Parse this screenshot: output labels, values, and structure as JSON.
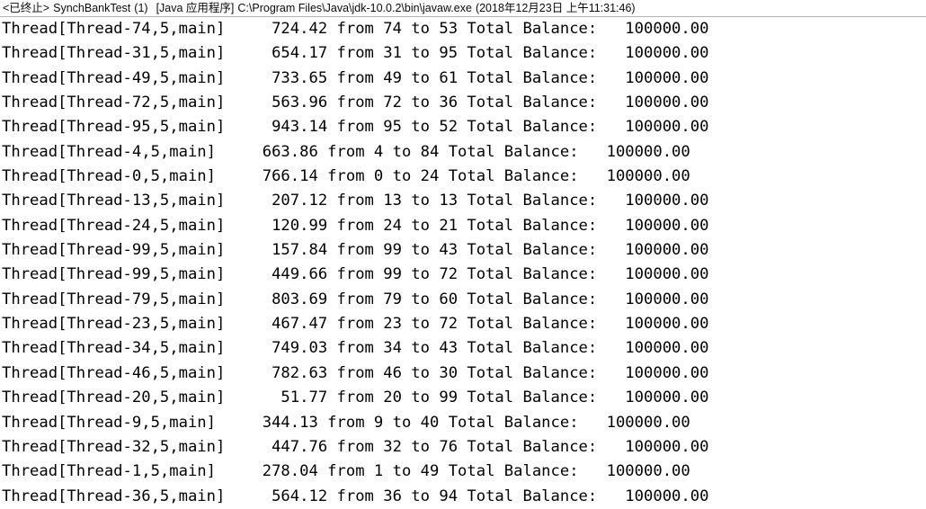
{
  "header": {
    "status": "<已终止>",
    "launch_config": "SynchBankTest",
    "instance": "(1)",
    "app_type": "[Java 应用程序]",
    "executable_path": "C:\\Program Files\\Java\\jdk-10.0.2\\bin\\javaw.exe",
    "timestamp": "(2018年12月23日 上午11:31:46)"
  },
  "console": {
    "format": "Thread[Thread-%d,5,main] %10.2f from %d to %d Total Balance: %10.2f",
    "total_balance_label": "Total Balance:",
    "from_label": "from",
    "to_label": "to",
    "lines": [
      "Thread[Thread-74,5,main]     724.42 from 74 to 53 Total Balance:   100000.00",
      "Thread[Thread-31,5,main]     654.17 from 31 to 95 Total Balance:   100000.00",
      "Thread[Thread-49,5,main]     733.65 from 49 to 61 Total Balance:   100000.00",
      "Thread[Thread-72,5,main]     563.96 from 72 to 36 Total Balance:   100000.00",
      "Thread[Thread-95,5,main]     943.14 from 95 to 52 Total Balance:   100000.00",
      "Thread[Thread-4,5,main]     663.86 from 4 to 84 Total Balance:   100000.00",
      "Thread[Thread-0,5,main]     766.14 from 0 to 24 Total Balance:   100000.00",
      "Thread[Thread-13,5,main]     207.12 from 13 to 13 Total Balance:   100000.00",
      "Thread[Thread-24,5,main]     120.99 from 24 to 21 Total Balance:   100000.00",
      "Thread[Thread-99,5,main]     157.84 from 99 to 43 Total Balance:   100000.00",
      "Thread[Thread-99,5,main]     449.66 from 99 to 72 Total Balance:   100000.00",
      "Thread[Thread-79,5,main]     803.69 from 79 to 60 Total Balance:   100000.00",
      "Thread[Thread-23,5,main]     467.47 from 23 to 72 Total Balance:   100000.00",
      "Thread[Thread-34,5,main]     749.03 from 34 to 43 Total Balance:   100000.00",
      "Thread[Thread-46,5,main]     782.63 from 46 to 30 Total Balance:   100000.00",
      "Thread[Thread-20,5,main]      51.77 from 20 to 99 Total Balance:   100000.00",
      "Thread[Thread-9,5,main]     344.13 from 9 to 40 Total Balance:   100000.00",
      "Thread[Thread-32,5,main]     447.76 from 32 to 76 Total Balance:   100000.00",
      "Thread[Thread-1,5,main]     278.04 from 1 to 49 Total Balance:   100000.00",
      "Thread[Thread-36,5,main]     564.12 from 36 to 94 Total Balance:   100000.00"
    ],
    "records": [
      {
        "thread": 74,
        "amount": "724.42",
        "from": 74,
        "to": 53,
        "total_balance": "100000.00"
      },
      {
        "thread": 31,
        "amount": "654.17",
        "from": 31,
        "to": 95,
        "total_balance": "100000.00"
      },
      {
        "thread": 49,
        "amount": "733.65",
        "from": 49,
        "to": 61,
        "total_balance": "100000.00"
      },
      {
        "thread": 72,
        "amount": "563.96",
        "from": 72,
        "to": 36,
        "total_balance": "100000.00"
      },
      {
        "thread": 95,
        "amount": "943.14",
        "from": 95,
        "to": 52,
        "total_balance": "100000.00"
      },
      {
        "thread": 4,
        "amount": "663.86",
        "from": 4,
        "to": 84,
        "total_balance": "100000.00"
      },
      {
        "thread": 0,
        "amount": "766.14",
        "from": 0,
        "to": 24,
        "total_balance": "100000.00"
      },
      {
        "thread": 13,
        "amount": "207.12",
        "from": 13,
        "to": 13,
        "total_balance": "100000.00"
      },
      {
        "thread": 24,
        "amount": "120.99",
        "from": 24,
        "to": 21,
        "total_balance": "100000.00"
      },
      {
        "thread": 99,
        "amount": "157.84",
        "from": 99,
        "to": 43,
        "total_balance": "100000.00"
      },
      {
        "thread": 99,
        "amount": "449.66",
        "from": 99,
        "to": 72,
        "total_balance": "100000.00"
      },
      {
        "thread": 79,
        "amount": "803.69",
        "from": 79,
        "to": 60,
        "total_balance": "100000.00"
      },
      {
        "thread": 23,
        "amount": "467.47",
        "from": 23,
        "to": 72,
        "total_balance": "100000.00"
      },
      {
        "thread": 34,
        "amount": "749.03",
        "from": 34,
        "to": 43,
        "total_balance": "100000.00"
      },
      {
        "thread": 46,
        "amount": "782.63",
        "from": 46,
        "to": 30,
        "total_balance": "100000.00"
      },
      {
        "thread": 20,
        "amount": "51.77",
        "from": 20,
        "to": 99,
        "total_balance": "100000.00"
      },
      {
        "thread": 9,
        "amount": "344.13",
        "from": 9,
        "to": 40,
        "total_balance": "100000.00"
      },
      {
        "thread": 32,
        "amount": "447.76",
        "from": 32,
        "to": 76,
        "total_balance": "100000.00"
      },
      {
        "thread": 1,
        "amount": "278.04",
        "from": 1,
        "to": 49,
        "total_balance": "100000.00"
      },
      {
        "thread": 36,
        "amount": "564.12",
        "from": 36,
        "to": 94,
        "total_balance": "100000.00"
      }
    ]
  },
  "colors": {
    "background": "#ffffff",
    "text": "#000000",
    "header_text": "#0a0a0a",
    "separator": "#b4b4b4"
  }
}
